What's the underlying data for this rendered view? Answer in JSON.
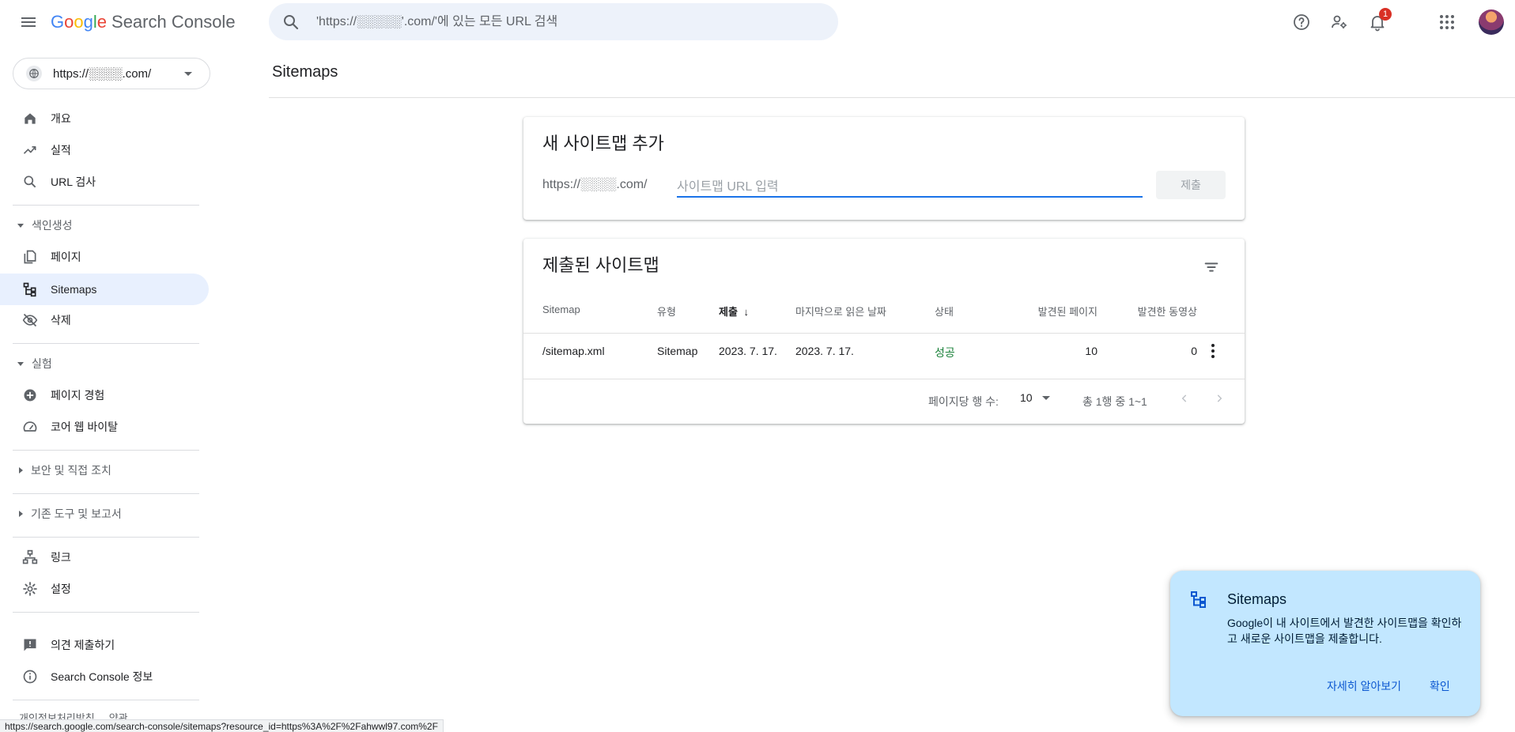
{
  "topbar": {
    "logo_google": [
      "G",
      "o",
      "o",
      "g",
      "l",
      "e"
    ],
    "logo_product": "Search Console",
    "search_placeholder": "'https://░░░░░'.com/'에 있는 모든 URL 검색",
    "notification_count": "1"
  },
  "sidebar": {
    "property_url": "https://░░░░.com/",
    "items": [
      {
        "label": "개요"
      },
      {
        "label": "실적"
      },
      {
        "label": "URL 검사"
      }
    ],
    "indexing_section": "색인생성",
    "indexing_items": [
      {
        "label": "페이지"
      },
      {
        "label": "Sitemaps"
      },
      {
        "label": "삭제"
      }
    ],
    "experience_section": "실험",
    "experience_items": [
      {
        "label": "페이지 경험"
      },
      {
        "label": "코어 웹 바이탈"
      }
    ],
    "security_section": "보안 및 직접 조치",
    "legacy_section": "기존 도구 및 보고서",
    "other_items": [
      {
        "label": "링크"
      },
      {
        "label": "설정"
      }
    ],
    "bottom_items": [
      {
        "label": "의견 제출하기"
      },
      {
        "label": "Search Console 정보"
      }
    ],
    "footer": {
      "privacy": "개인정보처리방침",
      "terms": "약관"
    }
  },
  "main": {
    "page_title": "Sitemaps",
    "add_card": {
      "title": "새 사이트맵 추가",
      "prefix": "https://░░░░.com/",
      "input_placeholder": "사이트맵 URL 입력",
      "input_value": "",
      "submit_label": "제출"
    },
    "submitted_card": {
      "title": "제출된 사이트맵",
      "columns": [
        "Sitemap",
        "유형",
        "제출",
        "마지막으로 읽은 날짜",
        "상태",
        "발견된 페이지",
        "발견한 동영상"
      ],
      "sort_arrow": "↓",
      "rows": [
        {
          "sitemap": "/sitemap.xml",
          "type": "Sitemap",
          "submitted": "2023. 7. 17.",
          "last_read": "2023. 7. 17.",
          "status": "성공",
          "pages": "10",
          "videos": "0"
        }
      ],
      "rows_per_page_label": "페이지당 행 수:",
      "rows_per_page_value": "10",
      "range_label": "총 1행 중 1~1"
    }
  },
  "tip": {
    "title": "Sitemaps",
    "body": "Google이 내 사이트에서 발견한 사이트맵을 확인하고 새로운 사이트맵을 제출합니다.",
    "learn_more": "자세히 알아보기",
    "confirm": "확인"
  },
  "status_bar_url": "https://search.google.com/search-console/sitemaps?resource_id=https%3A%2F%2Fahwwl97.com%2F",
  "colors": {
    "accent": "#1a73e8",
    "active_nav_bg": "#e8f0fe",
    "success": "#188038",
    "tip_bg": "#c2e7ff",
    "badge": "#d93025"
  }
}
